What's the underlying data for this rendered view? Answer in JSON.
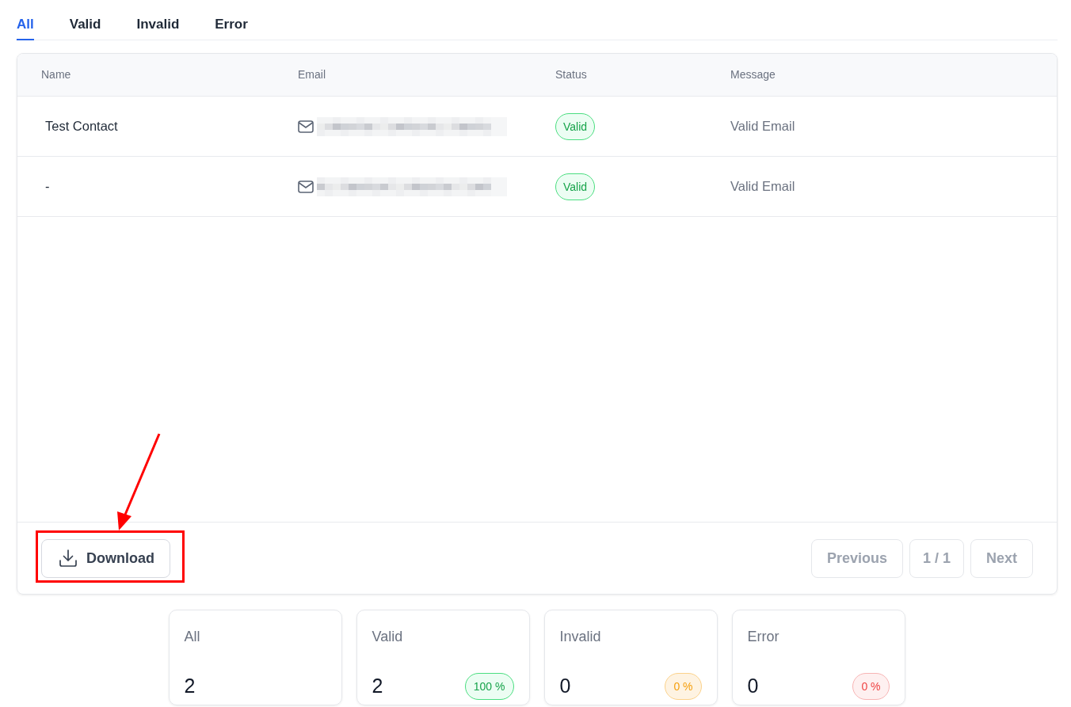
{
  "tabs": [
    {
      "label": "All",
      "selected": true
    },
    {
      "label": "Valid",
      "selected": false
    },
    {
      "label": "Invalid",
      "selected": false
    },
    {
      "label": "Error",
      "selected": false
    }
  ],
  "table": {
    "columns": [
      "Name",
      "Email",
      "Status",
      "Message"
    ],
    "rows": [
      {
        "name": "Test Contact",
        "status": {
          "label": "Valid",
          "kind": "valid"
        },
        "message": "Valid Email"
      },
      {
        "name": "-",
        "status": {
          "label": "Valid",
          "kind": "valid"
        },
        "message": "Valid Email"
      }
    ]
  },
  "download_button": {
    "label": "Download"
  },
  "pagination": {
    "previous": {
      "label": "Previous",
      "disabled": true
    },
    "page": "1 / 1",
    "next": {
      "label": "Next",
      "disabled": true
    }
  },
  "stats": [
    {
      "label": "All",
      "value": "2"
    },
    {
      "label": "Valid",
      "value": "2",
      "percent": "100 %",
      "kind": "valid"
    },
    {
      "label": "Invalid",
      "value": "0",
      "percent": "0 %",
      "kind": "invalid"
    },
    {
      "label": "Error",
      "value": "0",
      "percent": "0 %",
      "kind": "error"
    }
  ]
}
